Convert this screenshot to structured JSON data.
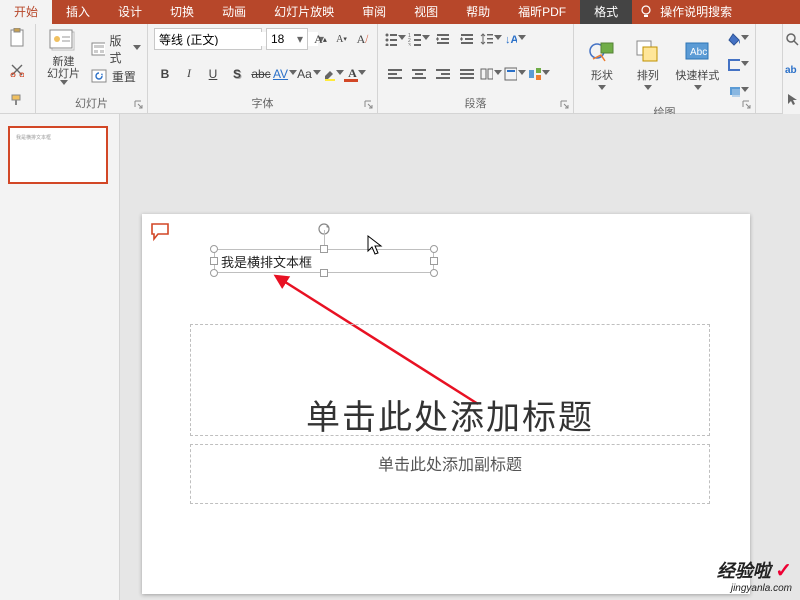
{
  "tabs": {
    "home": "开始",
    "insert": "插入",
    "design": "设计",
    "transition": "切换",
    "animation": "动画",
    "slideshow": "幻灯片放映",
    "review": "审阅",
    "view": "视图",
    "help": "帮助",
    "foxit": "福昕PDF",
    "format": "格式",
    "tellme": "操作说明搜索"
  },
  "slides_group": {
    "new_slide": "新建\n幻灯片",
    "layout": "版式",
    "reset": "重置",
    "label": "幻灯片"
  },
  "font_group": {
    "font_name": "等线 (正文)",
    "font_size": "18",
    "label": "字体"
  },
  "paragraph_group": {
    "label": "段落"
  },
  "drawing_group": {
    "shapes": "形状",
    "arrange": "排列",
    "quick_styles": "快速样式",
    "label": "绘图"
  },
  "slide": {
    "textbox_text": "我是横排文本框",
    "title_placeholder": "单击此处添加标题",
    "subtitle_placeholder": "单击此处添加副标题"
  },
  "watermark": {
    "title": "经验啦",
    "url": "jingyanla.com"
  }
}
